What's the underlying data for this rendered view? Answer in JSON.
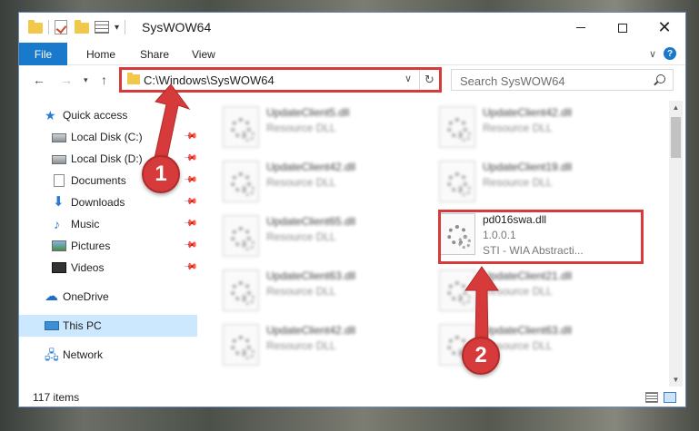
{
  "window": {
    "title": "SysWOW64",
    "minimize_label": "—",
    "maximize_label": "",
    "close_label": "✕"
  },
  "quick_access_toolbar": {
    "dropdown_label": "▾"
  },
  "ribbon": {
    "tabs": [
      {
        "label": "File"
      },
      {
        "label": "Home"
      },
      {
        "label": "Share"
      },
      {
        "label": "View"
      }
    ],
    "collapse_label": "∨",
    "help_label": "?"
  },
  "navigation": {
    "back_label": "←",
    "forward_label": "→",
    "recent_label": "▾",
    "up_label": "↑"
  },
  "address_bar": {
    "path": "C:\\Windows\\SysWOW64",
    "dropdown_label": "∨",
    "refresh_label": "↻"
  },
  "search": {
    "placeholder": "Search SysWOW64"
  },
  "sidebar": {
    "items": [
      {
        "label": "Quick access",
        "icon": "star-icon",
        "pinned": false
      },
      {
        "label": "Local Disk (C:)",
        "icon": "disk-icon",
        "pinned": true
      },
      {
        "label": "Local Disk (D:)",
        "icon": "disk-icon",
        "pinned": true
      },
      {
        "label": "Documents",
        "icon": "documents-icon",
        "pinned": true
      },
      {
        "label": "Downloads",
        "icon": "downloads-icon",
        "pinned": true
      },
      {
        "label": "Music",
        "icon": "music-icon",
        "pinned": true
      },
      {
        "label": "Pictures",
        "icon": "pictures-icon",
        "pinned": true
      },
      {
        "label": "Videos",
        "icon": "videos-icon",
        "pinned": true
      },
      {
        "label": "OneDrive",
        "icon": "onedrive-icon",
        "pinned": false
      },
      {
        "label": "This PC",
        "icon": "this-pc-icon",
        "pinned": false,
        "selected": true
      },
      {
        "label": "Network",
        "icon": "network-icon",
        "pinned": false
      }
    ],
    "pin_glyph": "📌"
  },
  "files": {
    "left_column": [
      {
        "name": "UpdateClient5.dll",
        "type": "Resource DLL"
      },
      {
        "name": "UpdateClient42.dll",
        "type": "Resource DLL"
      },
      {
        "name": "UpdateClient65.dll",
        "type": "Resource DLL"
      },
      {
        "name": "UpdateClient63.dll",
        "type": "Resource DLL"
      },
      {
        "name": "UpdateClient42.dll",
        "type": "Resource DLL"
      }
    ],
    "right_column": [
      {
        "name": "UpdateClient42.dll",
        "type": "Resource DLL"
      },
      {
        "name": "UpdateClient19.dll",
        "type": "Resource DLL"
      },
      {
        "name": "UpdateClient21.dll",
        "type": "Resource DLL"
      },
      {
        "name": "UpdateClient63.dll",
        "type": "Resource DLL"
      }
    ],
    "highlighted": {
      "name": "pd016swa.dll",
      "version": "1.0.0.1",
      "description": "STI - WIA Abstracti..."
    }
  },
  "status_bar": {
    "item_count": "117 items"
  },
  "annotations": {
    "callout_1": "1",
    "callout_2": "2",
    "highlight_color": "#d63a3a"
  },
  "colors": {
    "accent": "#1979ca",
    "selected_bg": "#cce8ff"
  }
}
